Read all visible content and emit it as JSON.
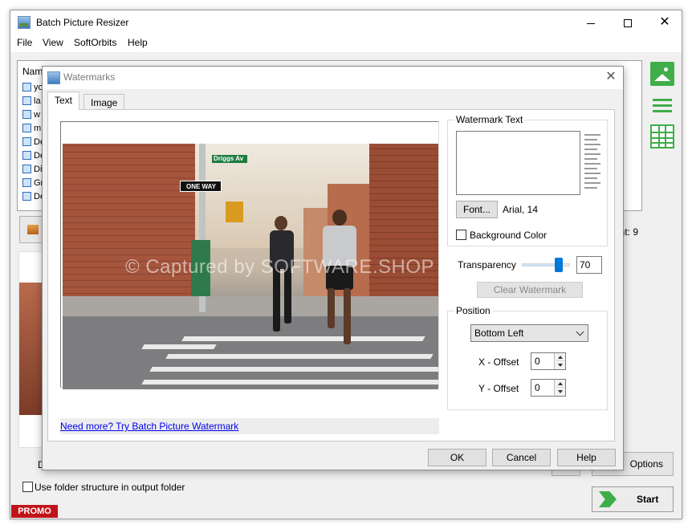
{
  "window": {
    "title": "Batch Picture Resizer",
    "controls": {
      "minimize": "",
      "maximize": "",
      "close": "✕"
    }
  },
  "menu": [
    "File",
    "View",
    "SoftOrbits",
    "Help"
  ],
  "file_list": {
    "column_header": "Nam",
    "rows": [
      "yo",
      "la",
      "w",
      "m",
      "De",
      "De",
      "Di",
      "Gr",
      "De"
    ]
  },
  "side_icons": [
    "image-icon",
    "list-view-icon",
    "grid-view-icon"
  ],
  "count_text": "unt: 9",
  "background_partial_label": "D",
  "folder_structure": {
    "label": "Use folder structure in output folder",
    "checked": false
  },
  "promo_label": "PROMO",
  "options_label": "Options",
  "start_label": "Start",
  "dialog": {
    "title": "Watermarks",
    "close": "✕",
    "tabs": [
      "Text",
      "Image"
    ],
    "active_tab": "Text",
    "preview": {
      "watermark_overlay": "© Captured by SOFTWARE.SHOP",
      "street_sign": "Driggs Av",
      "one_way_sign": "ONE WAY"
    },
    "more_link": "Need more? Try Batch Picture Watermark",
    "watermark_text": {
      "group_label": "Watermark Text",
      "value": "",
      "font_button": "Font...",
      "font_value": "Arial, 14"
    },
    "background_color": {
      "label": "Background Color",
      "checked": false
    },
    "transparency": {
      "label": "Transparency",
      "value": "70",
      "level": 70
    },
    "clear_button": "Clear Watermark",
    "position": {
      "group_label": "Position",
      "selected": "Bottom Left",
      "x_offset_label": "X - Offset",
      "x_offset": "0",
      "y_offset_label": "Y - Offset",
      "y_offset": "0"
    },
    "buttons": {
      "ok": "OK",
      "cancel": "Cancel",
      "help": "Help"
    }
  },
  "colors": {
    "accent_green": "#3fae49",
    "promo_red": "#c0141b",
    "slider_blue": "#0078d7",
    "link_blue": "#0000ee"
  }
}
